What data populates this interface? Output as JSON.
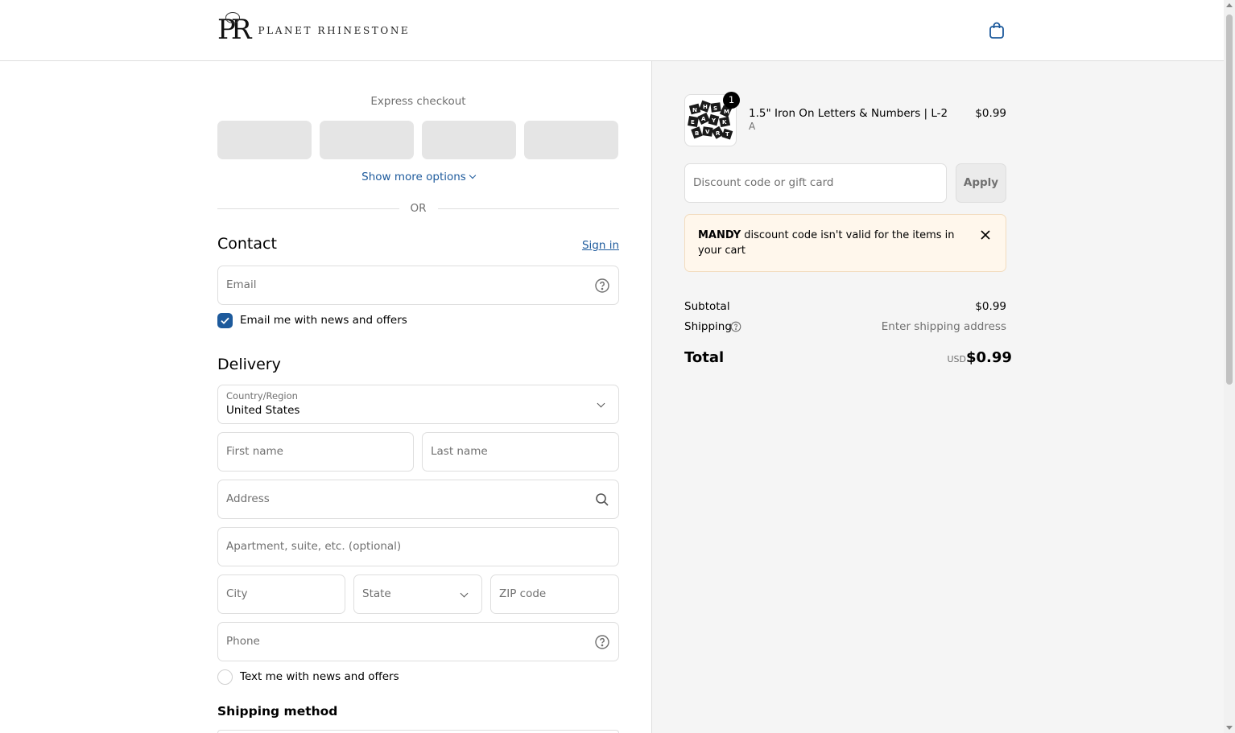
{
  "brand": {
    "name": "Planet Rhinestone",
    "monogram": "PR"
  },
  "header": {
    "cart_icon": "shopping-bag-icon"
  },
  "express": {
    "title": "Express checkout",
    "buttons": [
      "",
      "",
      "",
      ""
    ],
    "show_more": "Show more options",
    "or_label": "OR"
  },
  "contact": {
    "title": "Contact",
    "sign_in": "Sign in",
    "email_placeholder": "Email",
    "email_news_label": "Email me with news and offers",
    "email_news_checked": true
  },
  "delivery": {
    "title": "Delivery",
    "country_label": "Country/Region",
    "country_value": "United States",
    "first_name": "First name",
    "last_name": "Last name",
    "address": "Address",
    "apartment": "Apartment, suite, etc. (optional)",
    "city": "City",
    "state": "State",
    "zip": "ZIP code",
    "phone": "Phone",
    "text_news_label": "Text me with news and offers",
    "text_news_checked": false
  },
  "shipping_method": {
    "title": "Shipping method"
  },
  "order": {
    "item": {
      "name": "1.5\" Iron On Letters & Numbers | L-2",
      "variant": "A",
      "price": "$0.99",
      "quantity": "1"
    },
    "discount_placeholder": "Discount code or gift card",
    "apply_label": "Apply",
    "alert": {
      "code": "MANDY",
      "message": " discount code isn't valid for the items in your cart"
    },
    "subtotal_label": "Subtotal",
    "subtotal_value": "$0.99",
    "shipping_label": "Shipping",
    "shipping_value": "Enter shipping address",
    "total_label": "Total",
    "currency": "USD",
    "total_value": "$0.99"
  },
  "colors": {
    "accent": "#1d5a9c",
    "border": "#dedede",
    "summary_bg": "#f5f5f5",
    "alert_bg": "#fff7ec"
  }
}
